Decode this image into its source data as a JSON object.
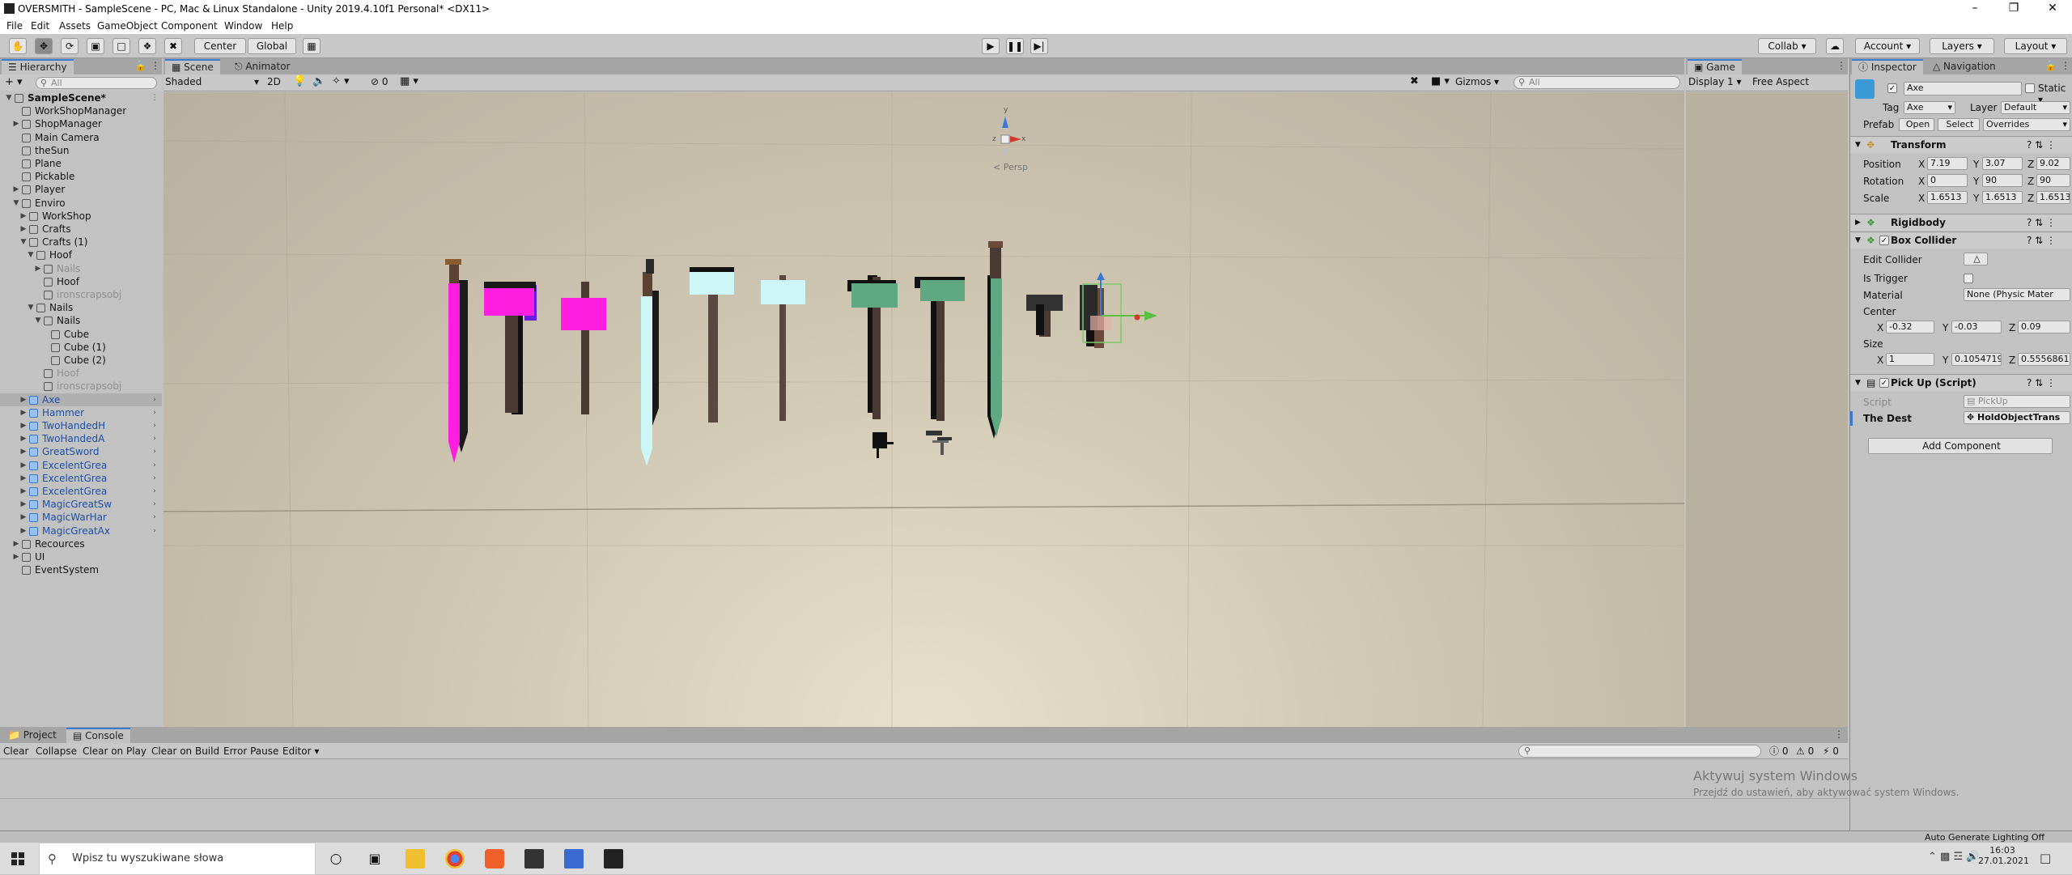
{
  "window": {
    "title": "OVERSMITH - SampleScene - PC, Mac & Linux Standalone - Unity 2019.4.10f1 Personal* <DX11>"
  },
  "menu": [
    "File",
    "Edit",
    "Assets",
    "GameObject",
    "Component",
    "Window",
    "Help"
  ],
  "toolbar": {
    "pivot": "Center",
    "space": "Global",
    "collab": "Collab",
    "account": "Account",
    "layers": "Layers",
    "layout": "Layout"
  },
  "hierarchy": {
    "tab": "Hierarchy",
    "search_placeholder": "All",
    "rows": [
      {
        "label": "SampleScene*",
        "state": "scene"
      },
      {
        "label": "WorkShopManager"
      },
      {
        "label": "ShopManager"
      },
      {
        "label": "Main Camera"
      },
      {
        "label": "theSun"
      },
      {
        "label": "Plane"
      },
      {
        "label": "Pickable"
      },
      {
        "label": "Player"
      },
      {
        "label": "Enviro"
      },
      {
        "label": "WorkShop"
      },
      {
        "label": "Crafts"
      },
      {
        "label": "Crafts (1)"
      },
      {
        "label": "Hoof"
      },
      {
        "label": "Nails",
        "state": "disabled"
      },
      {
        "label": "Hoof"
      },
      {
        "label": "ironscrapsobj",
        "state": "disabled"
      },
      {
        "label": "Nails"
      },
      {
        "label": "Nails"
      },
      {
        "label": "Cube"
      },
      {
        "label": "Cube (1)"
      },
      {
        "label": "Cube (2)"
      },
      {
        "label": "Hoof",
        "state": "disabled"
      },
      {
        "label": "ironscrapsobj",
        "state": "disabled"
      },
      {
        "label": "Axe",
        "state": "prefab"
      },
      {
        "label": "Hammer",
        "state": "prefab"
      },
      {
        "label": "TwoHandedH",
        "state": "prefab"
      },
      {
        "label": "TwoHandedA",
        "state": "prefab"
      },
      {
        "label": "GreatSword",
        "state": "prefab"
      },
      {
        "label": "ExcelentGrea",
        "state": "prefab"
      },
      {
        "label": "ExcelentGrea",
        "state": "prefab"
      },
      {
        "label": "ExcelentGrea",
        "state": "prefab"
      },
      {
        "label": "MagicGreatSw",
        "state": "prefab"
      },
      {
        "label": "MagicWarHar",
        "state": "prefab"
      },
      {
        "label": "MagicGreatAx",
        "state": "prefab"
      },
      {
        "label": "Recources"
      },
      {
        "label": "UI"
      },
      {
        "label": "EventSystem"
      }
    ]
  },
  "scene": {
    "tabs": [
      "Scene",
      "Animator"
    ],
    "shading": "Shaded",
    "mode2d": "2D",
    "hidden_count": "0",
    "gizmos": "Gizmos",
    "search_placeholder": "All",
    "persp": "< Persp"
  },
  "game": {
    "tab": "Game",
    "display": "Display 1",
    "aspect": "Free Aspect"
  },
  "inspector": {
    "tabs": [
      "Inspector",
      "Navigation"
    ],
    "object_name": "Axe",
    "static_label": "Static",
    "tag_label": "Tag",
    "tag_value": "Axe",
    "layer_label": "Layer",
    "layer_value": "Default",
    "prefab_label": "Prefab",
    "prefab_open": "Open",
    "prefab_select": "Select",
    "prefab_overrides": "Overrides",
    "transform": {
      "title": "Transform",
      "position_label": "Position",
      "position": {
        "x": "7.19",
        "y": "3.07",
        "z": "9.02"
      },
      "rotation_label": "Rotation",
      "rotation": {
        "x": "0",
        "y": "90",
        "z": "90"
      },
      "scale_label": "Scale",
      "scale": {
        "x": "1.6513",
        "y": "1.6513",
        "z": "1.6513"
      }
    },
    "rigidbody": {
      "title": "Rigidbody"
    },
    "box_collider": {
      "title": "Box Collider",
      "edit_collider": "Edit Collider",
      "is_trigger": "Is Trigger",
      "material_label": "Material",
      "material_value": "None (Physic Mater",
      "center_label": "Center",
      "center": {
        "x": "-0.32",
        "y": "-0.03",
        "z": "0.09"
      },
      "size_label": "Size",
      "size": {
        "x": "1",
        "y": "0.1054719",
        "z": "0.5556861"
      }
    },
    "pickup": {
      "title": "Pick Up (Script)",
      "script_label": "Script",
      "script_value": "PickUp",
      "dest_label": "The Dest",
      "dest_value": "HoldObjectTrans"
    },
    "add_component": "Add Component"
  },
  "bottom": {
    "tabs": [
      "Project",
      "Console"
    ],
    "buttons": [
      "Clear",
      "Collapse",
      "Clear on Play",
      "Clear on Build",
      "Error Pause",
      "Editor"
    ],
    "counts": {
      "log": "0",
      "warn": "0",
      "error": "0"
    },
    "watermark_title": "Aktywuj system Windows",
    "watermark_sub": "Przejdź do ustawień, aby aktywować system Windows."
  },
  "status": {
    "lighting": "Auto Generate Lighting Off"
  },
  "taskbar": {
    "search_placeholder": "Wpisz tu wyszukiwane słowa",
    "time": "16:03",
    "date": "27.01.2021"
  },
  "colors": {
    "accent": "#3a79d6",
    "magenta": "#ff1fe0",
    "cyan": "#cdf7f7",
    "green": "#5fa882",
    "handle": "#4a3a33"
  }
}
